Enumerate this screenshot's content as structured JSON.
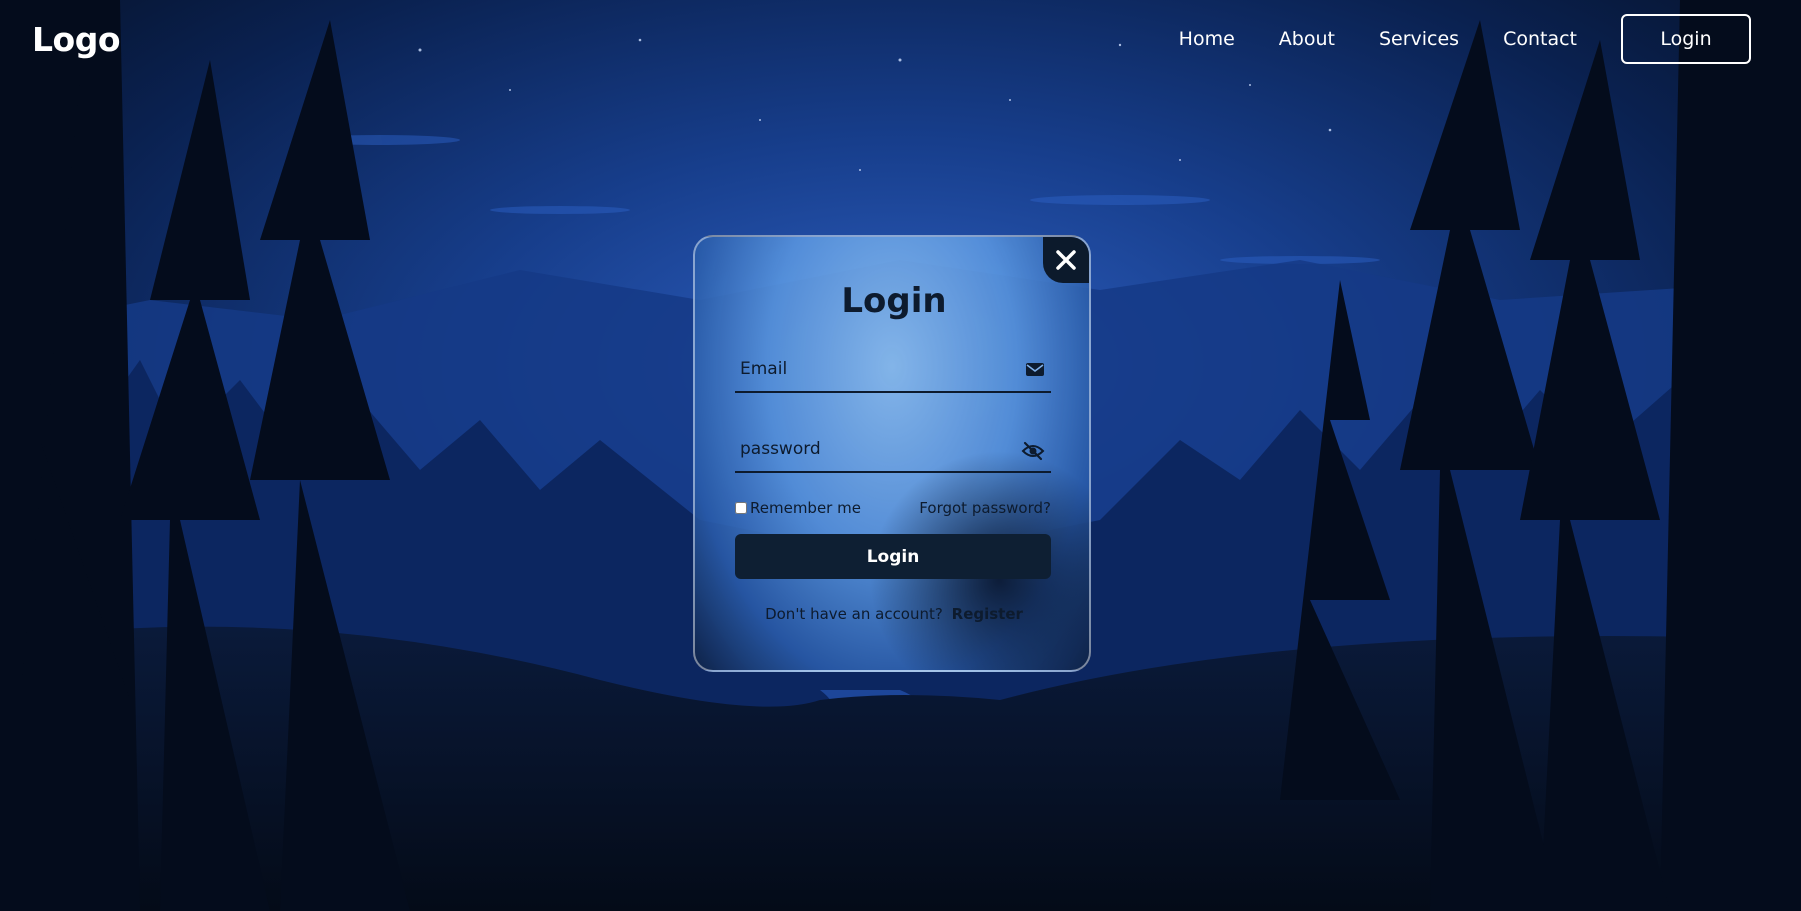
{
  "header": {
    "logo": "Logo",
    "nav": [
      "Home",
      "About",
      "Services",
      "Contact"
    ],
    "login_button": "Login"
  },
  "login_form": {
    "title": "Login",
    "email_placeholder": "Email",
    "password_placeholder": "password",
    "remember_label": "Remember me",
    "forgot_link": "Forgot password?",
    "submit_label": "Login",
    "register_prompt": "Don't have an account?",
    "register_link": "Register"
  },
  "icons": {
    "close": "close-icon",
    "email": "envelope-icon",
    "password": "eye-slash-icon"
  },
  "colors": {
    "background": "#061224",
    "card_text": "#0d1b2e",
    "button_bg": "#0e1f33",
    "accent_blue": "#5894de"
  }
}
